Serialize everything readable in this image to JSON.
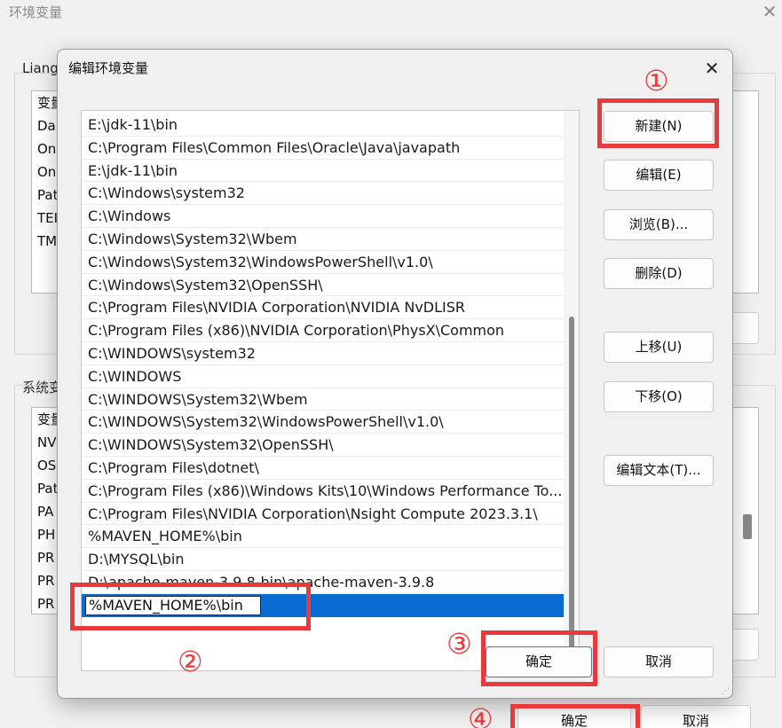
{
  "background_window": {
    "title": "环境变量",
    "user_section_label": "Liang",
    "user_list": {
      "header": "变量",
      "rows": [
        "Da",
        "On",
        "On",
        "Pat",
        "TEI",
        "TM"
      ]
    },
    "system_section_label": "系统变",
    "system_list": {
      "header": "变量",
      "rows": [
        "NV",
        "OS",
        "Pat",
        "PA",
        "PH",
        "PR",
        "PR",
        "PR"
      ]
    },
    "ok_label": "确定",
    "cancel_label": "取消"
  },
  "dialog": {
    "title": "编辑环境变量",
    "paths": [
      "E:\\jdk-11\\bin",
      "C:\\Program Files\\Common Files\\Oracle\\Java\\javapath",
      "E:\\jdk-11\\bin",
      "C:\\Windows\\system32",
      "C:\\Windows",
      "C:\\Windows\\System32\\Wbem",
      "C:\\Windows\\System32\\WindowsPowerShell\\v1.0\\",
      "C:\\Windows\\System32\\OpenSSH\\",
      "C:\\Program Files\\NVIDIA Corporation\\NVIDIA NvDLISR",
      "C:\\Program Files (x86)\\NVIDIA Corporation\\PhysX\\Common",
      "C:\\WINDOWS\\system32",
      "C:\\WINDOWS",
      "C:\\WINDOWS\\System32\\Wbem",
      "C:\\WINDOWS\\System32\\WindowsPowerShell\\v1.0\\",
      "C:\\WINDOWS\\System32\\OpenSSH\\",
      "C:\\Program Files\\dotnet\\",
      "C:\\Program Files (x86)\\Windows Kits\\10\\Windows Performance To...",
      "C:\\Program Files\\NVIDIA Corporation\\Nsight Compute 2023.3.1\\",
      "%MAVEN_HOME%\\bin",
      "D:\\MYSQL\\bin",
      "D:\\apache-maven-3.9.8-bin\\apache-maven-3.9.8"
    ],
    "editing_value": "%MAVEN_HOME%\\bin",
    "buttons": {
      "new": "新建(N)",
      "edit": "编辑(E)",
      "browse": "浏览(B)...",
      "delete": "删除(D)",
      "move_up": "上移(U)",
      "move_down": "下移(O)",
      "edit_text": "编辑文本(T)...",
      "ok": "确定",
      "cancel": "取消"
    }
  },
  "annotations": {
    "step1": "①",
    "step2": "②",
    "step3": "③",
    "step4": "④"
  },
  "colors": {
    "annotation_red": "#e8393b",
    "selection_blue": "#0a6bd3",
    "default_button_border": "#2d7fd6"
  }
}
